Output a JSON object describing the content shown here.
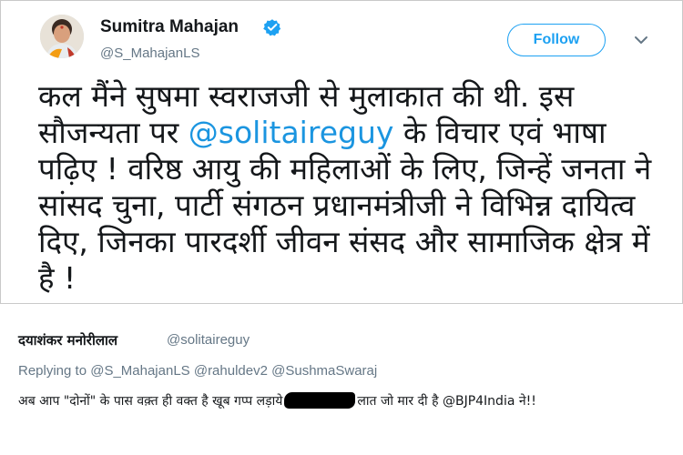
{
  "tweet": {
    "author_name": "Sumitra Mahajan",
    "handle": "@S_MahajanLS",
    "follow_label": "Follow",
    "text_before": "कल मैंने सुषमा स्वराजजी से मुलाकात की थी. इस सौजन्यता पर ",
    "mention": "@solitaireguy",
    "text_after": " के विचार एवं भाषा पढ़िए ! वरिष्ठ आयु की महिलाओं के लिए, जिन्हें जनता ने सांसद चुना, पार्टी संगठन प्रधानमंत्रीजी ने विभिन्न दायित्व दिए, जिनका पारदर्शी जीवन संसद और सामाजिक क्षेत्र में है !",
    "icons": {
      "verified": "verified-badge-icon",
      "more": "chevron-down-icon"
    },
    "colors": {
      "link": "#1b95e0",
      "follow": "#1da1f2",
      "secondary_text": "#657786"
    }
  },
  "reply": {
    "author_name": "दयाशंकर मनोरीलाल",
    "handle": "@solitaireguy",
    "replying_to": "Replying to @S_MahajanLS @rahuldev2 @SushmaSwaraj",
    "text_before": "अब आप \"दोनों\" के पास वक़्त ही वक्त है खूब गप्प लड़ाये",
    "text_after": "लात जो मार दी है @BJP4India ने!!"
  }
}
